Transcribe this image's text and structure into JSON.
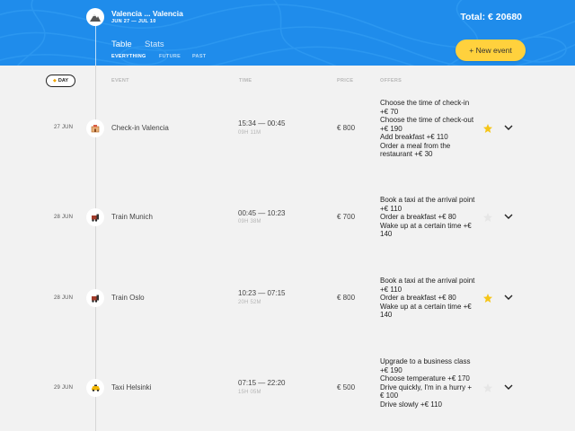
{
  "header": {
    "trip_title": "Valencia ... Valencia",
    "trip_dates": "JUN 27 — JUL 10",
    "total": "Total: € 20680",
    "new_event_label": "+ New event"
  },
  "view_tabs": [
    {
      "label": "Table",
      "active": true
    },
    {
      "label": "Stats",
      "active": false
    }
  ],
  "filters": [
    {
      "label": "EVERYTHING",
      "active": true
    },
    {
      "label": "FUTURE",
      "active": false
    },
    {
      "label": "PAST",
      "active": false
    }
  ],
  "columns": {
    "day": "DAY",
    "event": "EVENT",
    "time": "TIME",
    "price": "PRICE",
    "offers": "OFFERS"
  },
  "rows": [
    {
      "date": "27 JUN",
      "icon": "check-in-icon",
      "name": "Check-in Valencia",
      "time": "15:34 — 00:45",
      "duration": "09H 11M",
      "price": "€ 800",
      "offers": [
        "Choose the time of check-in +€ 70",
        "Choose the time of check-out +€ 190",
        "Add breakfast +€ 110",
        "Order a meal from the restaurant +€ 30"
      ],
      "favorite": true
    },
    {
      "date": "28 JUN",
      "icon": "train-icon",
      "name": "Train Munich",
      "time": "00:45 — 10:23",
      "duration": "09H 38M",
      "price": "€ 700",
      "offers": [
        "Book a taxi at the arrival point +€ 110",
        "Order a breakfast +€ 80",
        "Wake up at a certain time +€ 140"
      ],
      "favorite": false
    },
    {
      "date": "28 JUN",
      "icon": "train-icon",
      "name": "Train Oslo",
      "time": "10:23 — 07:15",
      "duration": "20H 52M",
      "price": "€ 800",
      "offers": [
        "Book a taxi at the arrival point +€ 110",
        "Order a breakfast +€ 80",
        "Wake up at a certain time +€ 140"
      ],
      "favorite": true
    },
    {
      "date": "29 JUN",
      "icon": "taxi-icon",
      "name": "Taxi Helsinki",
      "time": "07:15 — 22:20",
      "duration": "15H 05M",
      "price": "€ 500",
      "offers": [
        "Upgrade to a business class +€ 190",
        "Choose temperature +€ 170",
        "Drive quickly, I'm in a hurry +€ 100",
        "Drive slowly +€ 110"
      ],
      "favorite": false
    }
  ],
  "colors": {
    "header_blue": "#1f8ceb",
    "accent_yellow": "#ffd13d",
    "star_active": "#f5c518",
    "star_inactive": "#e6e6e6"
  }
}
